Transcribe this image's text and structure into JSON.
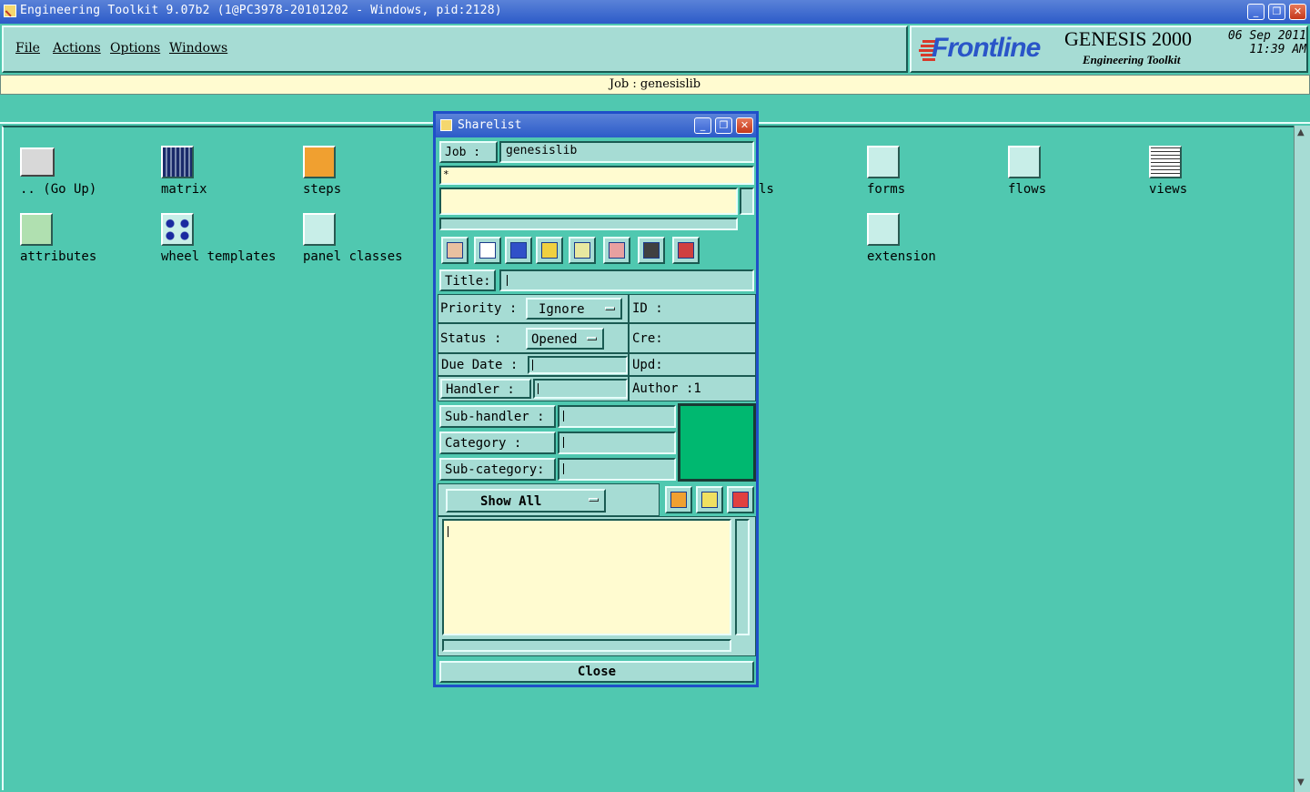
{
  "window": {
    "title": "Engineering Toolkit 9.07b2 (1@PC3978-20101202 - Windows, pid:2128)",
    "buttons": {
      "minimize": "_",
      "restore": "❐",
      "close": "✕"
    }
  },
  "menubar": {
    "items": [
      {
        "label": "File"
      },
      {
        "label": "Actions"
      },
      {
        "label": "Options"
      },
      {
        "label": "Windows"
      }
    ]
  },
  "branding": {
    "logo": "Frontline",
    "product": "GENESIS 2000",
    "subtitle": "Engineering Toolkit",
    "date": "06 Sep 2011",
    "time": "11:39 AM"
  },
  "jobbar": {
    "text": "Job : genesislib"
  },
  "items": [
    {
      "label": ".. (Go Up)",
      "icon": "folder-up-icon"
    },
    {
      "label": "matrix",
      "icon": "matrix-icon"
    },
    {
      "label": "steps",
      "icon": "steps-icon"
    },
    {
      "label": "ls",
      "icon": ""
    },
    {
      "label": "forms",
      "icon": "forms-icon"
    },
    {
      "label": "flows",
      "icon": "flows-icon"
    },
    {
      "label": "views",
      "icon": "views-icon"
    },
    {
      "label": "attributes",
      "icon": "attributes-icon"
    },
    {
      "label": "wheel templates",
      "icon": "wheel-templates-icon"
    },
    {
      "label": "panel classes",
      "icon": "panel-classes-icon"
    },
    {
      "label": "extension",
      "icon": "extension-icon"
    }
  ],
  "sharelist": {
    "title": "Sharelist",
    "job_label": "Job  :",
    "job_value": "genesislib",
    "filter_value": "*",
    "title_label": "Title:",
    "title_value": "",
    "priority_label": "Priority :",
    "priority_value": "Ignore",
    "id_label": "ID  :",
    "status_label": "Status   :",
    "status_value": "Opened",
    "cre_label": "Cre:",
    "due_label": "Due Date :",
    "upd_label": "Upd:",
    "handler_label": "Handler  :",
    "author_label": "Author :1",
    "subhandler_label": "Sub-handler :",
    "category_label": "Category    :",
    "subcategory_label": "Sub-category:",
    "status_color": "#00b870",
    "show_value": "Show All",
    "close_label": "Close"
  },
  "colors": {
    "background": "#50c8b0",
    "panel": "#a6dcd4",
    "cream": "#fffbd0",
    "titlebar": "#2c5bc8"
  }
}
